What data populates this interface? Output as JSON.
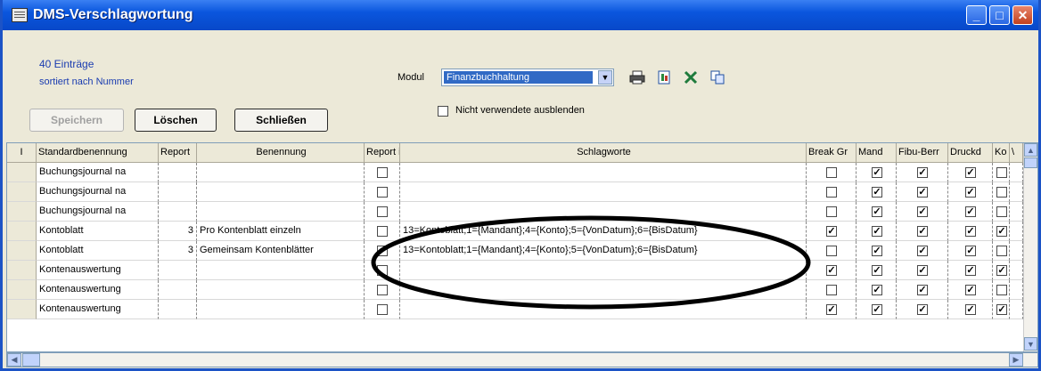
{
  "window": {
    "title": "DMS-Verschlagwortung",
    "controls": [
      "_",
      "□",
      "✕"
    ]
  },
  "info": {
    "count": "40 Einträge",
    "sort": "sortiert nach Nummer"
  },
  "modul": {
    "label": "Modul",
    "value": "Finanzbuchhaltung"
  },
  "checkbox_unused": {
    "label": "Nicht verwendete ausblenden",
    "checked": false
  },
  "toolbar_icons": [
    "printer-icon",
    "export-icon",
    "excel-icon",
    "copy-icon"
  ],
  "buttons": {
    "save": "Speichern",
    "delete": "Löschen",
    "close": "Schließen"
  },
  "grid": {
    "columns": [
      "I",
      "Standardbenennung",
      "Report",
      "Benennung",
      "Report i",
      "Schlagworte",
      "Break Gr",
      "Mand",
      "Fibu-Berr",
      "Druckd",
      "Ko",
      "\\"
    ],
    "rows": [
      {
        "std": "Buchungsjournal na",
        "report": "",
        "ben": "",
        "rep_i": false,
        "schlag": "",
        "brk": false,
        "mand": true,
        "fibu": true,
        "druck": true,
        "ko": false
      },
      {
        "std": "Buchungsjournal na",
        "report": "",
        "ben": "",
        "rep_i": false,
        "schlag": "",
        "brk": false,
        "mand": true,
        "fibu": true,
        "druck": true,
        "ko": false
      },
      {
        "std": "Buchungsjournal na",
        "report": "",
        "ben": "",
        "rep_i": false,
        "schlag": "",
        "brk": false,
        "mand": true,
        "fibu": true,
        "druck": true,
        "ko": false
      },
      {
        "std": "Kontoblatt",
        "report": "3",
        "ben": "Pro Kontenblatt einzeln",
        "rep_i": false,
        "schlag": "13=Kontoblatt;1={Mandant};4={Konto};5={VonDatum};6={BisDatum}",
        "brk": true,
        "mand": true,
        "fibu": true,
        "druck": true,
        "ko": true
      },
      {
        "std": "Kontoblatt",
        "report": "3",
        "ben": "Gemeinsam Kontenblätter",
        "rep_i": false,
        "schlag": "13=Kontoblatt;1={Mandant};4={Konto};5={VonDatum};6={BisDatum}",
        "brk": false,
        "mand": true,
        "fibu": true,
        "druck": true,
        "ko": false
      },
      {
        "std": "Kontenauswertung",
        "report": "",
        "ben": "",
        "rep_i": false,
        "schlag": "",
        "brk": true,
        "mand": true,
        "fibu": true,
        "druck": true,
        "ko": true
      },
      {
        "std": "Kontenauswertung",
        "report": "",
        "ben": "",
        "rep_i": false,
        "schlag": "",
        "brk": false,
        "mand": true,
        "fibu": true,
        "druck": true,
        "ko": false
      },
      {
        "std": "Kontenauswertung",
        "report": "",
        "ben": "",
        "rep_i": false,
        "schlag": "",
        "brk": true,
        "mand": true,
        "fibu": true,
        "druck": true,
        "ko": true
      }
    ]
  },
  "colors": {
    "title_bar": "#0a56de",
    "selection": "#316ac5",
    "link_text": "#1a3cb0",
    "annotation": "#000000"
  }
}
